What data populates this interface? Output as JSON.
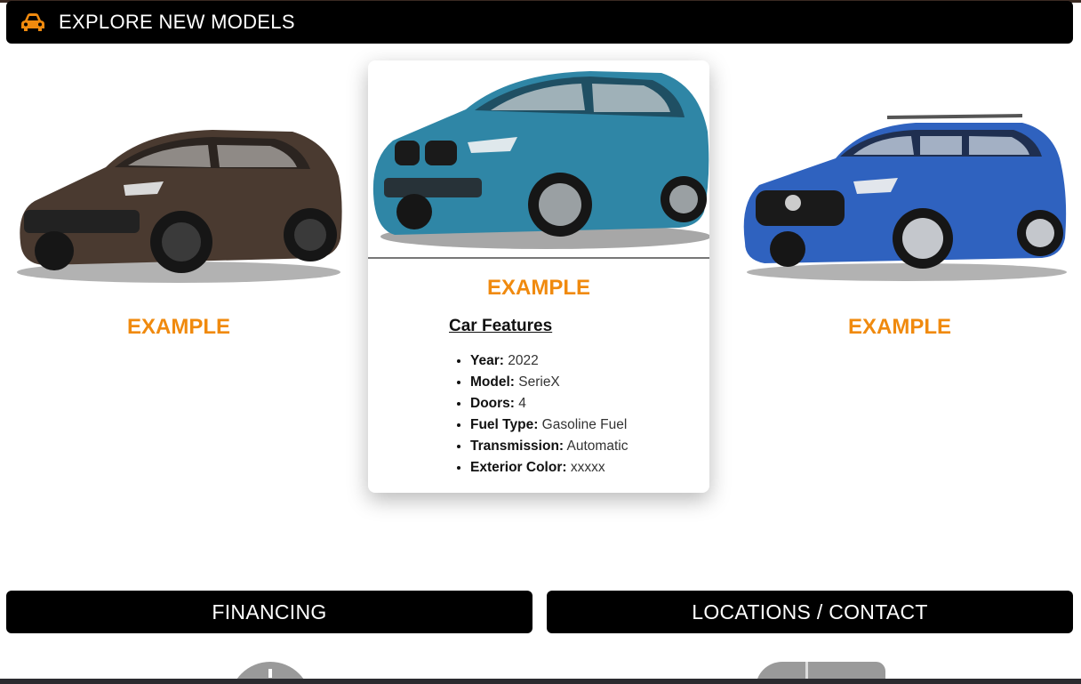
{
  "header": {
    "title": "EXPLORE NEW MODELS",
    "icon": "car-icon",
    "accent_color": "#f08a0e"
  },
  "cards": [
    {
      "name": "EXAMPLE",
      "car_color": "#4a3a30"
    },
    {
      "name": "EXAMPLE",
      "car_color": "#2f86a6",
      "features_title": "Car Features",
      "features": [
        {
          "label": "Year:",
          "value": "2022"
        },
        {
          "label": "Model:",
          "value": "SerieX"
        },
        {
          "label": "Doors:",
          "value": "4"
        },
        {
          "label": "Fuel Type:",
          "value": "Gasoline Fuel"
        },
        {
          "label": "Transmission:",
          "value": "Automatic"
        },
        {
          "label": "Exterior Color:",
          "value": "xxxxx"
        }
      ]
    },
    {
      "name": "EXAMPLE",
      "car_color": "#2f62bf"
    }
  ],
  "buttons": {
    "financing": "FINANCING",
    "locations_contact": "LOCATIONS   /   CONTACT"
  }
}
